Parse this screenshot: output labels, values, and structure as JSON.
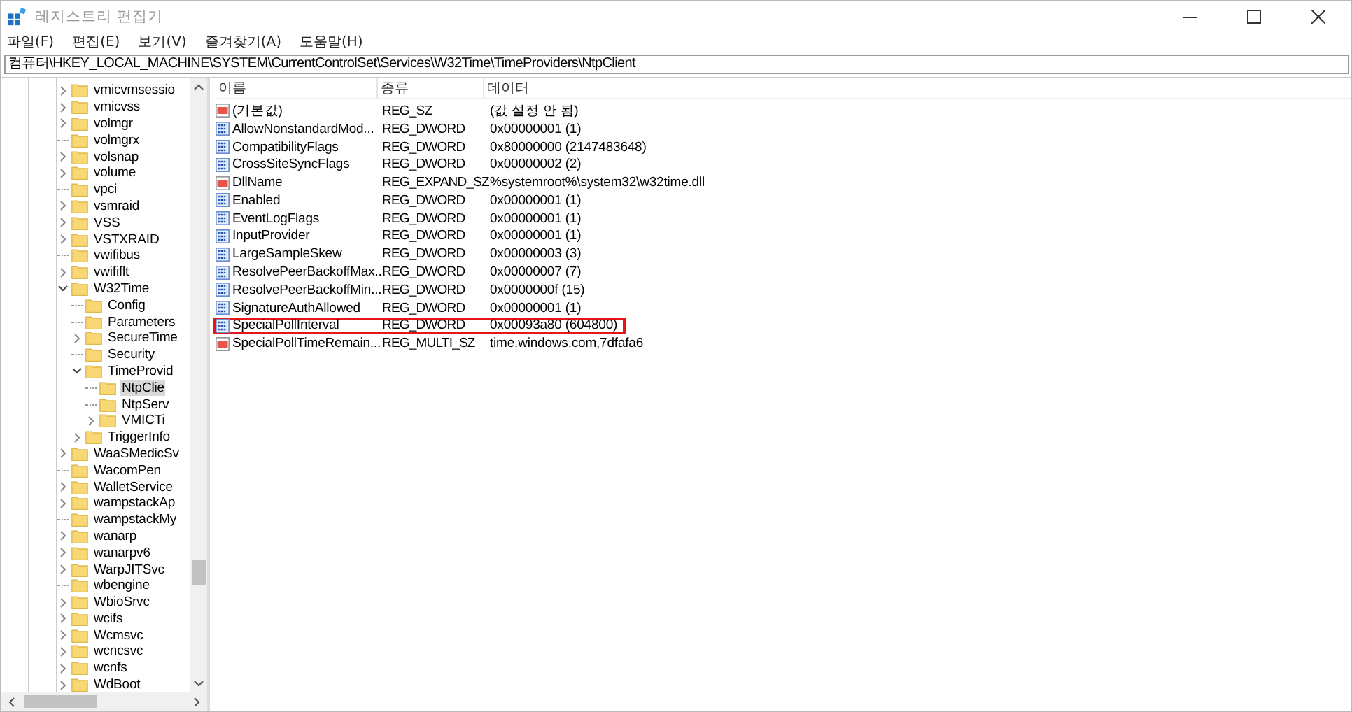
{
  "window": {
    "title": "레지스트리 편집기"
  },
  "menu": [
    "파일(F)",
    "편집(E)",
    "보기(V)",
    "즐겨찾기(A)",
    "도움말(H)"
  ],
  "address": "컴퓨터\\HKEY_LOCAL_MACHINE\\SYSTEM\\CurrentControlSet\\Services\\W32Time\\TimeProviders\\NtpClient",
  "tree": [
    {
      "label": "vmicvmsessio",
      "kind": "branch",
      "expanded": false,
      "selected": false
    },
    {
      "label": "vmicvss",
      "kind": "branch",
      "expanded": false,
      "selected": false
    },
    {
      "label": "volmgr",
      "kind": "branch",
      "expanded": false,
      "selected": false
    },
    {
      "label": "volmgrx",
      "kind": "leaf",
      "selected": false
    },
    {
      "label": "volsnap",
      "kind": "branch",
      "expanded": false,
      "selected": false
    },
    {
      "label": "volume",
      "kind": "branch",
      "expanded": false,
      "selected": false
    },
    {
      "label": "vpci",
      "kind": "leaf",
      "selected": false
    },
    {
      "label": "vsmraid",
      "kind": "branch",
      "expanded": false,
      "selected": false
    },
    {
      "label": "VSS",
      "kind": "branch",
      "expanded": false,
      "selected": false
    },
    {
      "label": "VSTXRAID",
      "kind": "branch",
      "expanded": false,
      "selected": false
    },
    {
      "label": "vwifibus",
      "kind": "leaf",
      "selected": false
    },
    {
      "label": "vwififlt",
      "kind": "branch",
      "expanded": false,
      "selected": false
    },
    {
      "label": "W32Time",
      "kind": "branch",
      "expanded": true,
      "selected": false,
      "children": [
        {
          "label": "Config",
          "kind": "leaf",
          "selected": false
        },
        {
          "label": "Parameters",
          "kind": "leaf",
          "selected": false
        },
        {
          "label": "SecureTime",
          "kind": "branch",
          "expanded": false,
          "selected": false
        },
        {
          "label": "Security",
          "kind": "leaf",
          "selected": false
        },
        {
          "label": "TimeProvid",
          "kind": "branch",
          "expanded": true,
          "selected": false,
          "children": [
            {
              "label": "NtpClie",
              "kind": "leaf",
              "selected": true
            },
            {
              "label": "NtpServ",
              "kind": "leaf",
              "selected": false
            },
            {
              "label": "VMICTi",
              "kind": "branch",
              "expanded": false,
              "selected": false
            }
          ]
        },
        {
          "label": "TriggerInfo",
          "kind": "branch",
          "expanded": false,
          "selected": false
        }
      ]
    },
    {
      "label": "WaaSMedicSv",
      "kind": "branch",
      "expanded": false,
      "selected": false
    },
    {
      "label": "WacomPen",
      "kind": "leaf",
      "selected": false
    },
    {
      "label": "WalletService",
      "kind": "branch",
      "expanded": false,
      "selected": false
    },
    {
      "label": "wampstackAp",
      "kind": "branch",
      "expanded": false,
      "selected": false
    },
    {
      "label": "wampstackMy",
      "kind": "leaf",
      "selected": false
    },
    {
      "label": "wanarp",
      "kind": "branch",
      "expanded": false,
      "selected": false
    },
    {
      "label": "wanarpv6",
      "kind": "branch",
      "expanded": false,
      "selected": false
    },
    {
      "label": "WarpJITSvc",
      "kind": "branch",
      "expanded": false,
      "selected": false
    },
    {
      "label": "wbengine",
      "kind": "leaf",
      "selected": false
    },
    {
      "label": "WbioSrvc",
      "kind": "branch",
      "expanded": false,
      "selected": false
    },
    {
      "label": "wcifs",
      "kind": "branch",
      "expanded": false,
      "selected": false
    },
    {
      "label": "Wcmsvc",
      "kind": "branch",
      "expanded": false,
      "selected": false
    },
    {
      "label": "wcncsvc",
      "kind": "branch",
      "expanded": false,
      "selected": false
    },
    {
      "label": "wcnfs",
      "kind": "branch",
      "expanded": false,
      "selected": false
    },
    {
      "label": "WdBoot",
      "kind": "branch",
      "expanded": false,
      "selected": false
    }
  ],
  "table": {
    "columns": [
      "이름",
      "종류",
      "데이터"
    ],
    "rows": [
      {
        "kind": "string",
        "name": "(기본값)",
        "type": "REG_SZ",
        "data": "(값 설정 안 됨)",
        "highlighted": false
      },
      {
        "kind": "binary",
        "name": "AllowNonstandardMod...",
        "type": "REG_DWORD",
        "data": "0x00000001 (1)",
        "highlighted": false
      },
      {
        "kind": "binary",
        "name": "CompatibilityFlags",
        "type": "REG_DWORD",
        "data": "0x80000000 (2147483648)",
        "highlighted": false
      },
      {
        "kind": "binary",
        "name": "CrossSiteSyncFlags",
        "type": "REG_DWORD",
        "data": "0x00000002 (2)",
        "highlighted": false
      },
      {
        "kind": "string",
        "name": "DllName",
        "type": "REG_EXPAND_SZ",
        "data": "%systemroot%\\system32\\w32time.dll",
        "highlighted": false
      },
      {
        "kind": "binary",
        "name": "Enabled",
        "type": "REG_DWORD",
        "data": "0x00000001 (1)",
        "highlighted": false
      },
      {
        "kind": "binary",
        "name": "EventLogFlags",
        "type": "REG_DWORD",
        "data": "0x00000001 (1)",
        "highlighted": false
      },
      {
        "kind": "binary",
        "name": "InputProvider",
        "type": "REG_DWORD",
        "data": "0x00000001 (1)",
        "highlighted": false
      },
      {
        "kind": "binary",
        "name": "LargeSampleSkew",
        "type": "REG_DWORD",
        "data": "0x00000003 (3)",
        "highlighted": false
      },
      {
        "kind": "binary",
        "name": "ResolvePeerBackoffMax...",
        "type": "REG_DWORD",
        "data": "0x00000007 (7)",
        "highlighted": false
      },
      {
        "kind": "binary",
        "name": "ResolvePeerBackoffMin...",
        "type": "REG_DWORD",
        "data": "0x0000000f (15)",
        "highlighted": false
      },
      {
        "kind": "binary",
        "name": "SignatureAuthAllowed",
        "type": "REG_DWORD",
        "data": "0x00000001 (1)",
        "highlighted": false
      },
      {
        "kind": "binary",
        "name": "SpecialPollInterval",
        "type": "REG_DWORD",
        "data": "0x00093a80 (604800)",
        "highlighted": true
      },
      {
        "kind": "string",
        "name": "SpecialPollTimeRemain...",
        "type": "REG_MULTI_SZ",
        "data": "time.windows.com,7dfafa6",
        "highlighted": false
      }
    ]
  }
}
